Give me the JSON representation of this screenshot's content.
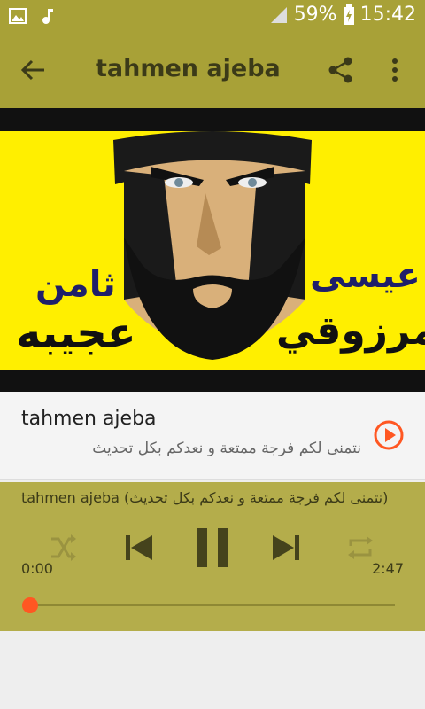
{
  "status_bar": {
    "battery_percent": "59%",
    "time": "15:42",
    "icons": [
      "image-icon",
      "music-note-icon",
      "signal-icon",
      "battery-charging-icon"
    ]
  },
  "app_bar": {
    "title": "tahmen ajeba",
    "icons": [
      "back-arrow-icon",
      "share-icon",
      "more-vert-icon"
    ]
  },
  "cover": {
    "text_line1": "عيسى",
    "text_line2": "المرزوقي",
    "text_line3": "ثامن",
    "text_line4": "عجيبه"
  },
  "track": {
    "title": "tahmen ajeba",
    "subtitle": "نتمنى لكم فرجة ممتعة و نعدكم بكل تحديث"
  },
  "player": {
    "now_playing": "tahmen ajeba (نتمنى لكم فرجة ممتعة و نعدكم بكل تحديث)",
    "time_current": "0:00",
    "time_total": "2:47",
    "progress": 0.0
  },
  "colors": {
    "accent": "#a8a137",
    "player_bg": "#b4ad4b",
    "seek_thumb": "#ff5722",
    "cover_bg": "#ffef00"
  }
}
